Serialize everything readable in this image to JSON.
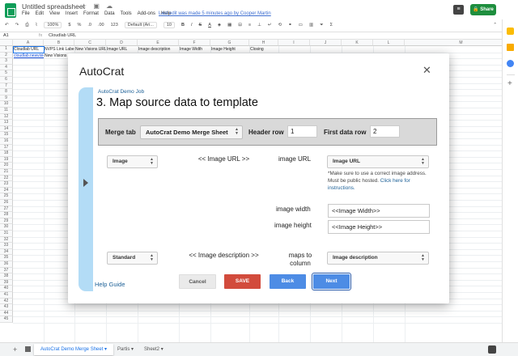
{
  "doc": {
    "title": "Untitled spreadsheet",
    "title_icons": "☆ ▣ ☁",
    "last_edit": "Last edit was made 5 minutes ago by Cooper Martin",
    "share_label": "🔒 Share"
  },
  "menu": [
    "File",
    "Edit",
    "View",
    "Insert",
    "Format",
    "Data",
    "Tools",
    "Add-ons",
    "Help"
  ],
  "toolbar": {
    "zoom": "100%",
    "currency": "$",
    "percent": "%",
    "dec_less": ".0",
    "dec_more": ".00",
    "numfmt": "123",
    "font": "Default (Ari...",
    "size": "10",
    "bold": "B",
    "italic": "I",
    "strike": "S",
    "textcolor": "A"
  },
  "formula_bar": {
    "cell_ref": "A1",
    "fx": "fx",
    "value": "Cloudlab URL"
  },
  "grid": {
    "columns": [
      "A",
      "B",
      "C",
      "D",
      "E",
      "F",
      "G",
      "H",
      "I",
      "J",
      "K",
      "L",
      "M"
    ],
    "rows": [
      "1",
      "2",
      "3",
      "4",
      "5",
      "6",
      "7",
      "8",
      "9",
      "10",
      "11",
      "12",
      "13",
      "14",
      "15",
      "16",
      "17",
      "18",
      "19",
      "20",
      "21",
      "22",
      "23",
      "24",
      "25",
      "26",
      "27",
      "28",
      "29",
      "30",
      "31",
      "32",
      "33",
      "34",
      "35",
      "36",
      "37",
      "38",
      "39",
      "40",
      "41",
      "42",
      "43",
      "44",
      "45"
    ],
    "row1": [
      "Cloudlab URL",
      "NVPS Link Label",
      "New Visions URL",
      "Image URL",
      "Image description",
      "Image Width",
      "Image Height",
      "Closing"
    ],
    "row2": [
      "cloudlab.newvisions.org",
      "New Visions"
    ]
  },
  "tabs": [
    {
      "label": "AutoCrat Demo Merge Sheet",
      "caret": "▾"
    },
    {
      "label": "Partis",
      "caret": "▾"
    },
    {
      "label": "Sheet2",
      "caret": "▾"
    }
  ],
  "modal": {
    "app_title": "AutoCrat",
    "close": "✕",
    "job_name": "AutoCrat Demo Job",
    "step_title": "3. Map source data to template",
    "merge_tab_label": "Merge tab",
    "merge_tab_value": "AutoCrat Demo Merge Sheet",
    "header_row_label": "Header row",
    "header_row_value": "1",
    "first_data_row_label": "First data row",
    "first_data_row_value": "2",
    "row1": {
      "type": "Image",
      "source_tag": "<< Image URL >>",
      "field_label": "image URL",
      "column": "Image URL"
    },
    "note_text": "*Make sure to use a correct image address. Must be public hosted. ",
    "note_link": "Click here for instructions.",
    "width_label": "image width",
    "width_value": "<<Image Width>>",
    "height_label": "image height",
    "height_value": "<<Image Height>>",
    "row2": {
      "type": "Standard",
      "source_tag": "<< Image description >>",
      "maps_label": "maps to column",
      "column": "Image description"
    },
    "help_label": "Help Guide",
    "cancel_label": "Cancel",
    "save_label": "SAVE",
    "back_label": "Back",
    "next_label": "Next"
  },
  "colors": {
    "accent": "#4d8ce5",
    "save": "#d24b3c",
    "share": "#1e8e3e",
    "strip": "#b3dcf6"
  }
}
